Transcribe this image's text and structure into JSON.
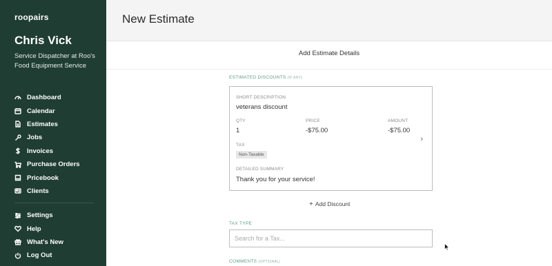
{
  "sidebar": {
    "logo": "roopairs",
    "user_name": "Chris Vick",
    "user_role": "Service Dispatcher at Roo's Food Equipment Service",
    "nav_items": [
      {
        "label": "Dashboard",
        "icon": "dashboard-icon"
      },
      {
        "label": "Calendar",
        "icon": "calendar-icon"
      },
      {
        "label": "Estimates",
        "icon": "document-icon"
      },
      {
        "label": "Jobs",
        "icon": "wrench-icon"
      },
      {
        "label": "Invoices",
        "icon": "dollar-icon"
      },
      {
        "label": "Purchase Orders",
        "icon": "cart-icon"
      },
      {
        "label": "Pricebook",
        "icon": "book-icon"
      },
      {
        "label": "Clients",
        "icon": "id-card-icon"
      }
    ],
    "bottom_items": [
      {
        "label": "Settings",
        "icon": "sliders-icon"
      },
      {
        "label": "Help",
        "icon": "heart-icon"
      },
      {
        "label": "What's New",
        "icon": "gift-icon"
      },
      {
        "label": "Log Out",
        "icon": "power-icon"
      }
    ],
    "colors": {
      "background": "#1f3d33",
      "text": "#ffffff"
    }
  },
  "header": {
    "title": "New Estimate"
  },
  "section": {
    "title": "Add Estimate Details"
  },
  "discounts": {
    "label": "ESTIMATED DISCOUNTS",
    "optional_note": "(IF ANY)",
    "card": {
      "short_description_label": "SHORT DESCRIPTION",
      "short_description": "veterans discount",
      "qty_label": "QTY",
      "qty": "1",
      "price_label": "PRICE",
      "price": "-$75.00",
      "amount_label": "AMOUNT",
      "amount": "-$75.00",
      "tax_label": "TAX",
      "tax_value": "Non-Taxable",
      "summary_label": "DETAILED SUMMARY",
      "summary": "Thank you for your service!"
    },
    "add_label": "Add Discount"
  },
  "tax_type": {
    "label": "TAX TYPE",
    "placeholder": "Search for a Tax..."
  },
  "comments": {
    "label": "COMMENTS",
    "optional_note": "(OPTIONAL)"
  },
  "accent_color": "#5f9a86"
}
